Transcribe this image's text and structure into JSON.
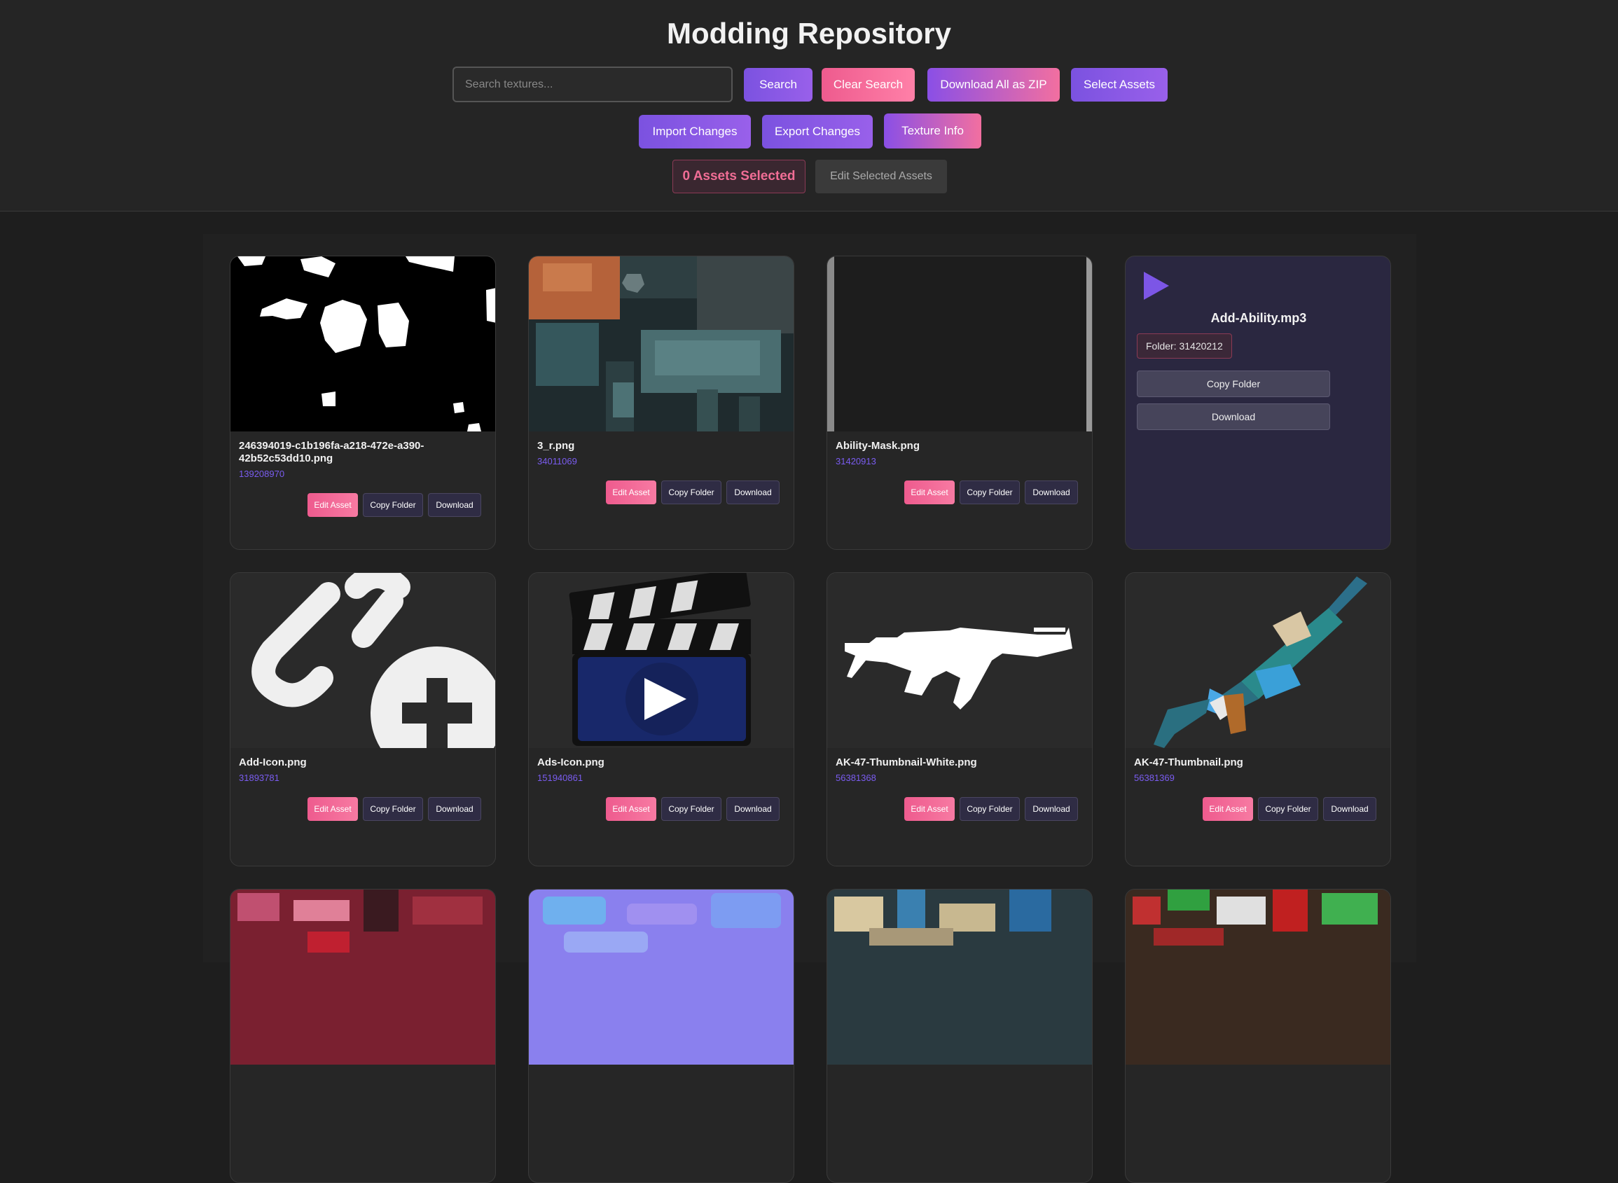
{
  "header": {
    "title": "Modding Repository",
    "search_placeholder": "Search textures...",
    "search_label": "Search",
    "clear_label": "Clear Search",
    "download_zip_label": "Download All as ZIP",
    "select_label": "Select Assets",
    "import_label": "Import Changes",
    "export_label": "Export Changes",
    "info_label": "Texture Info",
    "selected_count": "0 Assets Selected",
    "edit_selected_label": "Edit Selected Assets"
  },
  "card_actions": {
    "edit": "Edit Asset",
    "copy": "Copy Folder",
    "download": "Download"
  },
  "assets": [
    {
      "name": "246394019-c1b196fa-a218-472e-a390-42b52c53dd10.png",
      "folder": "139208970"
    },
    {
      "name": "3_r.png",
      "folder": "34011069"
    },
    {
      "name": "Ability-Mask.png",
      "folder": "31420913"
    },
    {
      "name": "Add-Icon.png",
      "folder": "31893781"
    },
    {
      "name": "Ads-Icon.png",
      "folder": "151940861"
    },
    {
      "name": "AK-47-Thumbnail-White.png",
      "folder": "56381368"
    },
    {
      "name": "AK-47-Thumbnail.png",
      "folder": "56381369"
    }
  ],
  "audio_asset": {
    "name": "Add-Ability.mp3",
    "folder_label": "Folder: 31420212",
    "copy_label": "Copy Folder",
    "download_label": "Download",
    "icon": "play-icon"
  },
  "colors": {
    "accent_purple": "#7b52e0",
    "accent_pink": "#ee5b8e",
    "folder_id": "#7a5cf0"
  }
}
